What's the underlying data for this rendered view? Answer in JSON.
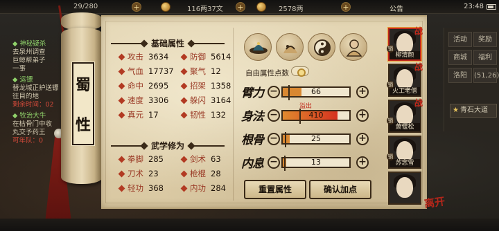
{
  "topbar": {
    "stamina": "29/280",
    "copper": "116两37文",
    "gold": "2578两",
    "notice": "公告",
    "clock": "23:48"
  },
  "quest_log": [
    {
      "type": "title",
      "text": "◆ 神秘疑杀"
    },
    {
      "type": "line",
      "text": "去泉州调查"
    },
    {
      "type": "line",
      "text": "巨鲸帮弟子"
    },
    {
      "type": "line",
      "text": "一事"
    },
    {
      "type": "gap"
    },
    {
      "type": "title",
      "text": "◆ 运镖"
    },
    {
      "type": "line",
      "text": "替龙城正护送镖"
    },
    {
      "type": "line",
      "text": "往目的地"
    },
    {
      "type": "red",
      "text": "剩余时间：02"
    },
    {
      "type": "gap"
    },
    {
      "type": "title",
      "text": "◆ 牧治大牛"
    },
    {
      "type": "line",
      "text": "在枯骨门中收"
    },
    {
      "type": "line",
      "text": "丸交予药王"
    },
    {
      "type": "red",
      "text": "可年队：0"
    }
  ],
  "side_panel": {
    "buttons": [
      "活动",
      "奖励",
      "商城",
      "福利",
      "洛阳",
      "(51,26)"
    ],
    "road": "青石大道"
  },
  "scroll_title": [
    "蜀",
    "性"
  ],
  "basic": {
    "heading": "基础属性",
    "stats": [
      {
        "label": "攻击",
        "value": "3634"
      },
      {
        "label": "防御",
        "value": "5614"
      },
      {
        "label": "气血",
        "value": "17737"
      },
      {
        "label": "聚气",
        "value": "12"
      },
      {
        "label": "命中",
        "value": "2695"
      },
      {
        "label": "招架",
        "value": "1358"
      },
      {
        "label": "速度",
        "value": "3306"
      },
      {
        "label": "躲闪",
        "value": "3164"
      },
      {
        "label": "真元",
        "value": "17"
      },
      {
        "label": "韧性",
        "value": "132"
      }
    ]
  },
  "martial": {
    "heading": "武学修为",
    "stats": [
      {
        "label": "拳脚",
        "value": "285"
      },
      {
        "label": "剑术",
        "value": "63"
      },
      {
        "label": "刀术",
        "value": "23"
      },
      {
        "label": "枪棍",
        "value": "28"
      },
      {
        "label": "轻功",
        "value": "368"
      },
      {
        "label": "内功",
        "value": "284"
      }
    ]
  },
  "allocation": {
    "free_label": "自由属性点数",
    "overflow_label": "溢出",
    "attributes": [
      {
        "name": "臂力",
        "value": "66",
        "fill": 0.28,
        "over": false
      },
      {
        "name": "身法",
        "value": "410",
        "fill": 0.82,
        "over": true
      },
      {
        "name": "根骨",
        "value": "25",
        "fill": 0.1,
        "over": false
      },
      {
        "name": "内息",
        "value": "13",
        "fill": 0.05,
        "over": false
      }
    ],
    "reset_label": "重置属性",
    "confirm_label": "确认加点"
  },
  "portraits": [
    {
      "name": "柳清颜",
      "mark": "战",
      "selected": true
    },
    {
      "name": "火工老僧",
      "mark": "战",
      "selected": false
    },
    {
      "name": "萧偃松",
      "mark": "战",
      "selected": false
    },
    {
      "name": "苏念雪",
      "mark": "",
      "selected": false
    },
    {
      "name": "",
      "mark": "",
      "selected": false
    }
  ],
  "seal": "离开",
  "colors": {
    "accent_red": "#c0291b",
    "bar_orange": "#d88832",
    "paper": "#e4d6b4",
    "ink": "#2a1d12",
    "quest_green": "#8fd16a"
  }
}
